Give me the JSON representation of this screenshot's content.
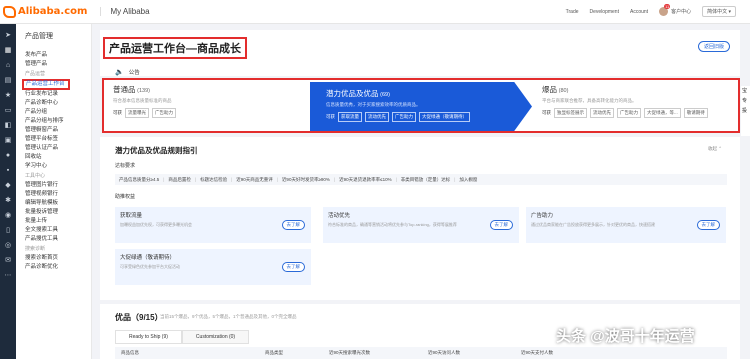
{
  "topbar": {
    "logo_text": "Alibaba.com",
    "app_title": "My Alibaba",
    "links": [
      "Trade",
      "Development",
      "Account"
    ],
    "badge": "11",
    "user_label": "客户中心",
    "lang": "简体中文"
  },
  "sidebar": {
    "title": "产品管理",
    "items": [
      {
        "label": "发布产品",
        "type": "item"
      },
      {
        "label": "管理产品",
        "type": "item"
      },
      {
        "label": "产品运营",
        "type": "group"
      },
      {
        "label": "产品运营工作台",
        "type": "active"
      },
      {
        "label": "行业发布记录",
        "type": "item"
      },
      {
        "label": "产品诊断中心",
        "type": "item"
      },
      {
        "label": "产品分组",
        "type": "item"
      },
      {
        "label": "产品分组与排序",
        "type": "item"
      },
      {
        "label": "管理橱窗产品",
        "type": "item"
      },
      {
        "label": "管理平台标签",
        "type": "item"
      },
      {
        "label": "管理认证产品",
        "type": "item"
      },
      {
        "label": "回收站",
        "type": "item"
      },
      {
        "label": "学习中心",
        "type": "item"
      },
      {
        "label": "工具中心",
        "type": "group"
      },
      {
        "label": "管理图片银行",
        "type": "item"
      },
      {
        "label": "管理视频银行",
        "type": "item"
      },
      {
        "label": "编辑导航模板",
        "type": "item"
      },
      {
        "label": "批量投诉管理",
        "type": "item"
      },
      {
        "label": "批量上传",
        "type": "item"
      },
      {
        "label": "全文搜索工具",
        "type": "item"
      },
      {
        "label": "产品搜优工具",
        "type": "item"
      },
      {
        "label": "搜索诊断",
        "type": "group"
      },
      {
        "label": "搜索诊断首页",
        "type": "item"
      },
      {
        "label": "产品诊断优化",
        "type": "item"
      }
    ]
  },
  "header": {
    "title": "产品运营工作台—商品成长",
    "button": "返回旧版",
    "notice": "公告"
  },
  "stages": [
    {
      "name": "普通品",
      "count": "(139)",
      "desc": "符合基本信息质量标准的商品",
      "prefix": "可获",
      "tags": [
        "流量曝光",
        "广告助力"
      ]
    },
    {
      "name": "潜力优品及优品",
      "count": "(69)",
      "desc": "信息质量优秀，对于买家搜索效率的优质商品。",
      "prefix": "可获",
      "tags": [
        "获取流量",
        "流动优先",
        "广告助力",
        "大促绿通（敬请期待）"
      ]
    },
    {
      "name": "爆品",
      "count": "(80)",
      "desc": "平台与商家联合推荐，具备高转化能力的商品。",
      "prefix": "可获",
      "tags": [
        "独显标签展示",
        "流动优先",
        "广告助力",
        "大促绿通，等...",
        "敬请期待"
      ]
    }
  ],
  "guide": {
    "title": "潜力优品及优品规则指引",
    "collapse": "收起",
    "req_label": "达标要求",
    "requirements": [
      "产品信息质量分≥4.5",
      "商品后置检",
      "标题达信检验",
      "近90天商品无重评",
      "近90天好时发货率≥90%",
      "近90天退货退款率率≤10%",
      "非类目错放（定量）达标",
      "加入橱窗"
    ],
    "benefit_label": "助推权益",
    "cards": [
      {
        "title": "获取流量",
        "desc": "加曝权益加优先权，可获得更多曝光机会",
        "btn": "去了解"
      },
      {
        "title": "活动优先",
        "desc": "符合标准的商品，确通等营销活动将优先参与Top-ranking，获得等展推荐",
        "btn": "去了解"
      },
      {
        "title": "广告助力",
        "desc": "通过优品商家能在广告投放获得更多展示，针对更优的商品，快速搭建",
        "btn": "去了解"
      },
      {
        "title": "大促绿通（敬请期待）",
        "desc": "可享受绿色优先参加平台大促活动",
        "btn": "去了解"
      }
    ]
  },
  "list": {
    "title": "优品（9/15）",
    "meta": "当前15个爆品，9个优品，5个爆品，1个普通品及其他，0个完全爆品",
    "tabs": [
      "Ready to Ship (9)",
      "Customization (0)"
    ],
    "columns": [
      "商品信息",
      "商品类型",
      "近90天搜索曝光次数",
      "近90天访问人数",
      "近90天支付人数"
    ]
  },
  "right_strip": [
    "宝",
    "专",
    "投"
  ],
  "watermark": "头条 @波哥十年运营"
}
